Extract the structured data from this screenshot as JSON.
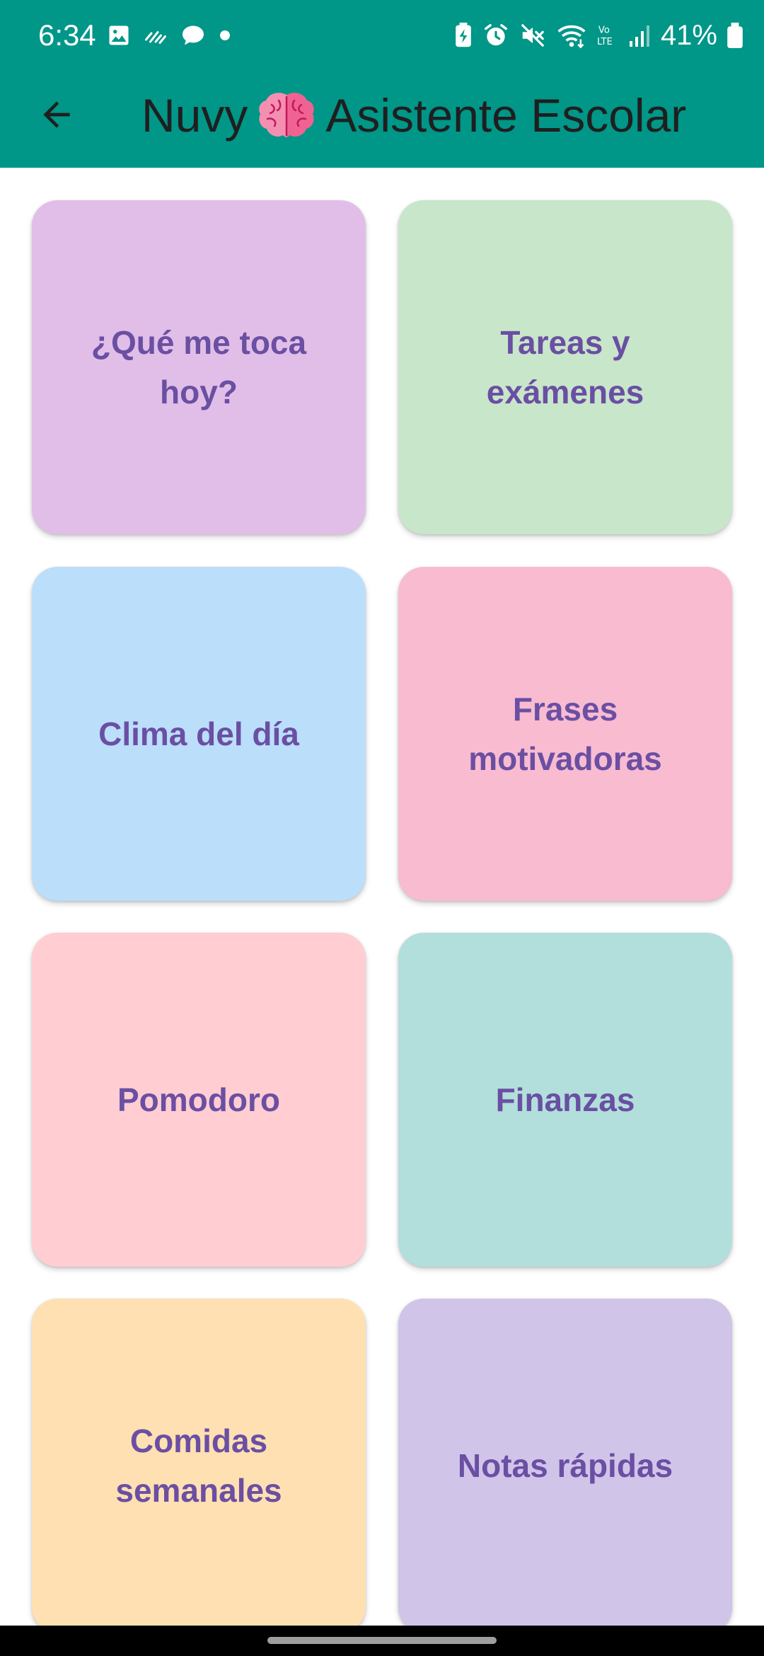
{
  "status_bar": {
    "time": "6:34",
    "battery": "41%",
    "icons": [
      "image-icon",
      "activity-icon",
      "chat-bubble-icon",
      "dot-icon",
      "battery-saver-icon",
      "alarm-icon",
      "mute-icon",
      "wifi-icon",
      "volte-icon",
      "signal-icon",
      "battery-icon"
    ]
  },
  "app_bar": {
    "title_prefix": "Nuvy",
    "title_emoji": "brain-icon",
    "title_suffix": "Asistente Escolar"
  },
  "tiles": [
    {
      "label": "¿Qué me toca hoy?",
      "color": "#e1bee7"
    },
    {
      "label": "Tareas y exámenes",
      "color": "#c8e6c9"
    },
    {
      "label": "Clima del día",
      "color": "#bbdefb"
    },
    {
      "label": "Frases motivadoras",
      "color": "#f8bbd0"
    },
    {
      "label": "Pomodoro",
      "color": "#ffcdd2"
    },
    {
      "label": "Finanzas",
      "color": "#b2dfdb"
    },
    {
      "label": "Comidas semanales",
      "color": "#ffe0b2"
    },
    {
      "label": "Notas rápidas",
      "color": "#d1c4e9"
    }
  ],
  "colors": {
    "header": "#009688",
    "tile_text": "#6a4fa3"
  }
}
